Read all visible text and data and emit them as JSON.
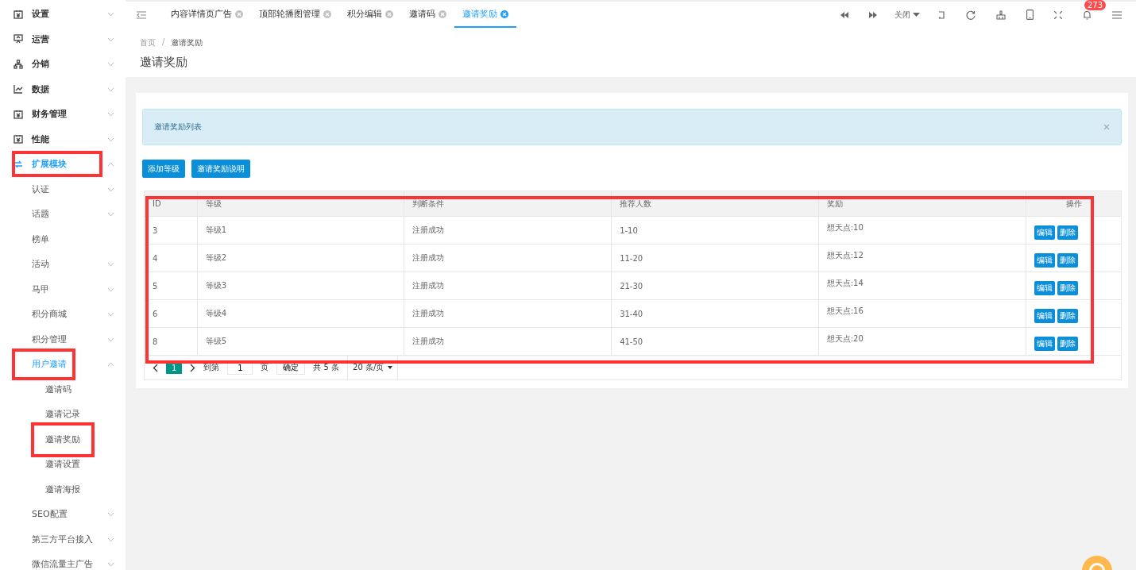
{
  "sidebar": {
    "items": [
      {
        "label": "设置",
        "kind": "folder",
        "expanded": false,
        "active": false,
        "marked": false
      },
      {
        "label": "运营",
        "kind": "folder",
        "expanded": false,
        "active": false,
        "marked": false
      },
      {
        "label": "分销",
        "kind": "folder",
        "expanded": false,
        "active": false,
        "marked": false
      },
      {
        "label": "数据",
        "kind": "folder",
        "expanded": false,
        "active": false,
        "marked": false
      },
      {
        "label": "财务管理",
        "kind": "folder",
        "expanded": false,
        "active": false,
        "marked": false
      },
      {
        "label": "性能",
        "kind": "folder",
        "expanded": false,
        "active": false,
        "marked": false
      },
      {
        "label": "扩展模块",
        "kind": "folder",
        "expanded": true,
        "active": true,
        "marked": true,
        "children": [
          {
            "label": "认证",
            "kind": "folder",
            "expanded": false,
            "active": false,
            "marked": false
          },
          {
            "label": "话题",
            "kind": "folder",
            "expanded": false,
            "active": false,
            "marked": false
          },
          {
            "label": "榜单",
            "kind": "link",
            "expanded": false,
            "active": false,
            "marked": false
          },
          {
            "label": "活动",
            "kind": "folder",
            "expanded": false,
            "active": false,
            "marked": false
          },
          {
            "label": "马甲",
            "kind": "folder",
            "expanded": false,
            "active": false,
            "marked": false
          },
          {
            "label": "积分商城",
            "kind": "folder",
            "expanded": false,
            "active": false,
            "marked": false
          },
          {
            "label": "积分管理",
            "kind": "folder",
            "expanded": false,
            "active": false,
            "marked": false
          },
          {
            "label": "用户邀请",
            "kind": "folder",
            "expanded": true,
            "active": true,
            "marked": true,
            "children": [
              {
                "label": "邀请码",
                "active": false,
                "marked": false
              },
              {
                "label": "邀请记录",
                "active": false,
                "marked": false
              },
              {
                "label": "邀请奖励",
                "active": false,
                "marked": true
              },
              {
                "label": "邀请设置",
                "active": false,
                "marked": false
              },
              {
                "label": "邀请海报",
                "active": false,
                "marked": false
              }
            ]
          },
          {
            "label": "SEO配置",
            "kind": "folder",
            "expanded": false,
            "active": false,
            "marked": false
          },
          {
            "label": "第三方平台接入",
            "kind": "folder",
            "expanded": false,
            "active": false,
            "marked": false
          },
          {
            "label": "微信流量主广告",
            "kind": "folder",
            "expanded": false,
            "active": false,
            "marked": false
          }
        ]
      }
    ]
  },
  "tabs": [
    {
      "label": "内容详情页广告",
      "selected": false
    },
    {
      "label": "顶部轮播图管理",
      "selected": false
    },
    {
      "label": "积分编辑",
      "selected": false
    },
    {
      "label": "邀请码",
      "selected": false
    },
    {
      "label": "邀请奖励",
      "selected": true
    }
  ],
  "toolbar": {
    "close_menu": "关闭",
    "notification_count": "273"
  },
  "breadcrumb": {
    "separator": "/",
    "items": [
      "首页",
      "邀请奖励"
    ]
  },
  "page_title": "邀请奖励",
  "alert": {
    "text": "邀请奖励列表"
  },
  "buttons": [
    "添加等级",
    "邀请奖励说明"
  ],
  "table": {
    "marked": true,
    "columns": [
      "ID",
      "等级",
      "判断条件",
      "推荐人数",
      "奖励",
      "操作"
    ],
    "rows": [
      {
        "cells": [
          "3",
          "等级1",
          "注册成功",
          "1-10",
          "想天点:10"
        ],
        "actions": [
          "编辑",
          "删除"
        ]
      },
      {
        "cells": [
          "4",
          "等级2",
          "注册成功",
          "11-20",
          "想天点:12"
        ],
        "actions": [
          "编辑",
          "删除"
        ]
      },
      {
        "cells": [
          "5",
          "等级3",
          "注册成功",
          "21-30",
          "想天点:14"
        ],
        "actions": [
          "编辑",
          "删除"
        ]
      },
      {
        "cells": [
          "6",
          "等级4",
          "注册成功",
          "31-40",
          "想天点:16"
        ],
        "actions": [
          "编辑",
          "删除"
        ]
      },
      {
        "cells": [
          "8",
          "等级5",
          "注册成功",
          "41-50",
          "想天点:20"
        ],
        "actions": [
          "编辑",
          "删除"
        ]
      }
    ]
  },
  "pagination": {
    "pages": [
      {
        "label": "1",
        "selected": true
      }
    ],
    "goto_label": "到第",
    "page_value": "1",
    "page_unit": "页",
    "confirm": "确定",
    "total": "共 5 条",
    "page_size": "20 条/页"
  }
}
